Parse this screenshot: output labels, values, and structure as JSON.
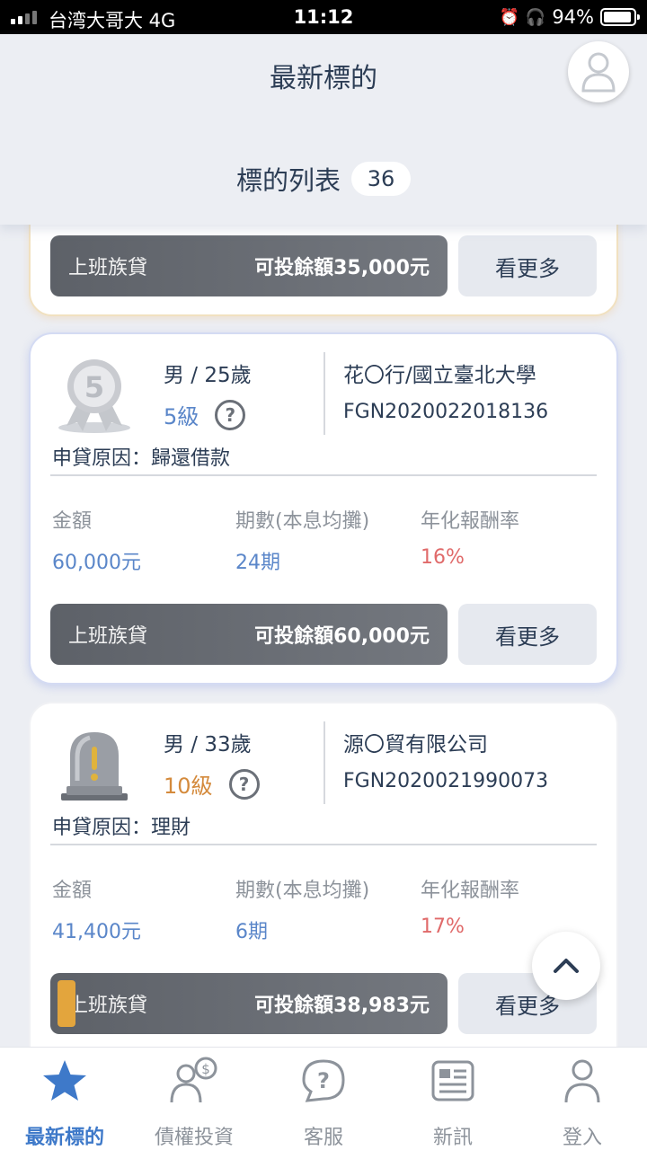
{
  "status_bar": {
    "carrier": "台湾大哥大  4G",
    "time": "11:12",
    "battery": "94%"
  },
  "header": {
    "title": "最新標的",
    "list_title": "標的列表",
    "count": "36"
  },
  "cards": [
    {
      "loan_type": "上班族貸",
      "remaining": "可投餘額35,000元",
      "more": "看更多"
    },
    {
      "bio": "男 / 25歲",
      "grade": "5級",
      "badge_number": "5",
      "company": "花〇行/國立臺北大學",
      "loan_id": "FGN2020022018136",
      "reason": "申貸原因：歸還借款",
      "labels": {
        "amount": "金額",
        "term": "期數(本息均攤)",
        "rate": "年化報酬率"
      },
      "amount": "60,000元",
      "term": "24期",
      "rate": "16%",
      "loan_type": "上班族貸",
      "remaining": "可投餘額60,000元",
      "more": "看更多"
    },
    {
      "bio": "男 / 33歲",
      "grade": "10級",
      "company": "源〇貿有限公司",
      "loan_id": "FGN2020021990073",
      "reason": "申貸原因：理財",
      "labels": {
        "amount": "金額",
        "term": "期數(本息均攤)",
        "rate": "年化報酬率"
      },
      "amount": "41,400元",
      "term": "6期",
      "rate": "17%",
      "loan_type": "上班族貸",
      "remaining": "可投餘額38,983元",
      "more": "看更多"
    }
  ],
  "tabs": [
    {
      "label": "最新標的",
      "icon": "star-icon",
      "active": true
    },
    {
      "label": "債權投資",
      "icon": "investor-icon"
    },
    {
      "label": "客服",
      "icon": "support-icon"
    },
    {
      "label": "新訊",
      "icon": "news-icon"
    },
    {
      "label": "登入",
      "icon": "login-icon"
    }
  ],
  "colors": {
    "accent": "#3e79c9",
    "value_blue": "#5a86c9",
    "rate_red": "#e06a6a",
    "grade_orange": "#d48a3c"
  }
}
